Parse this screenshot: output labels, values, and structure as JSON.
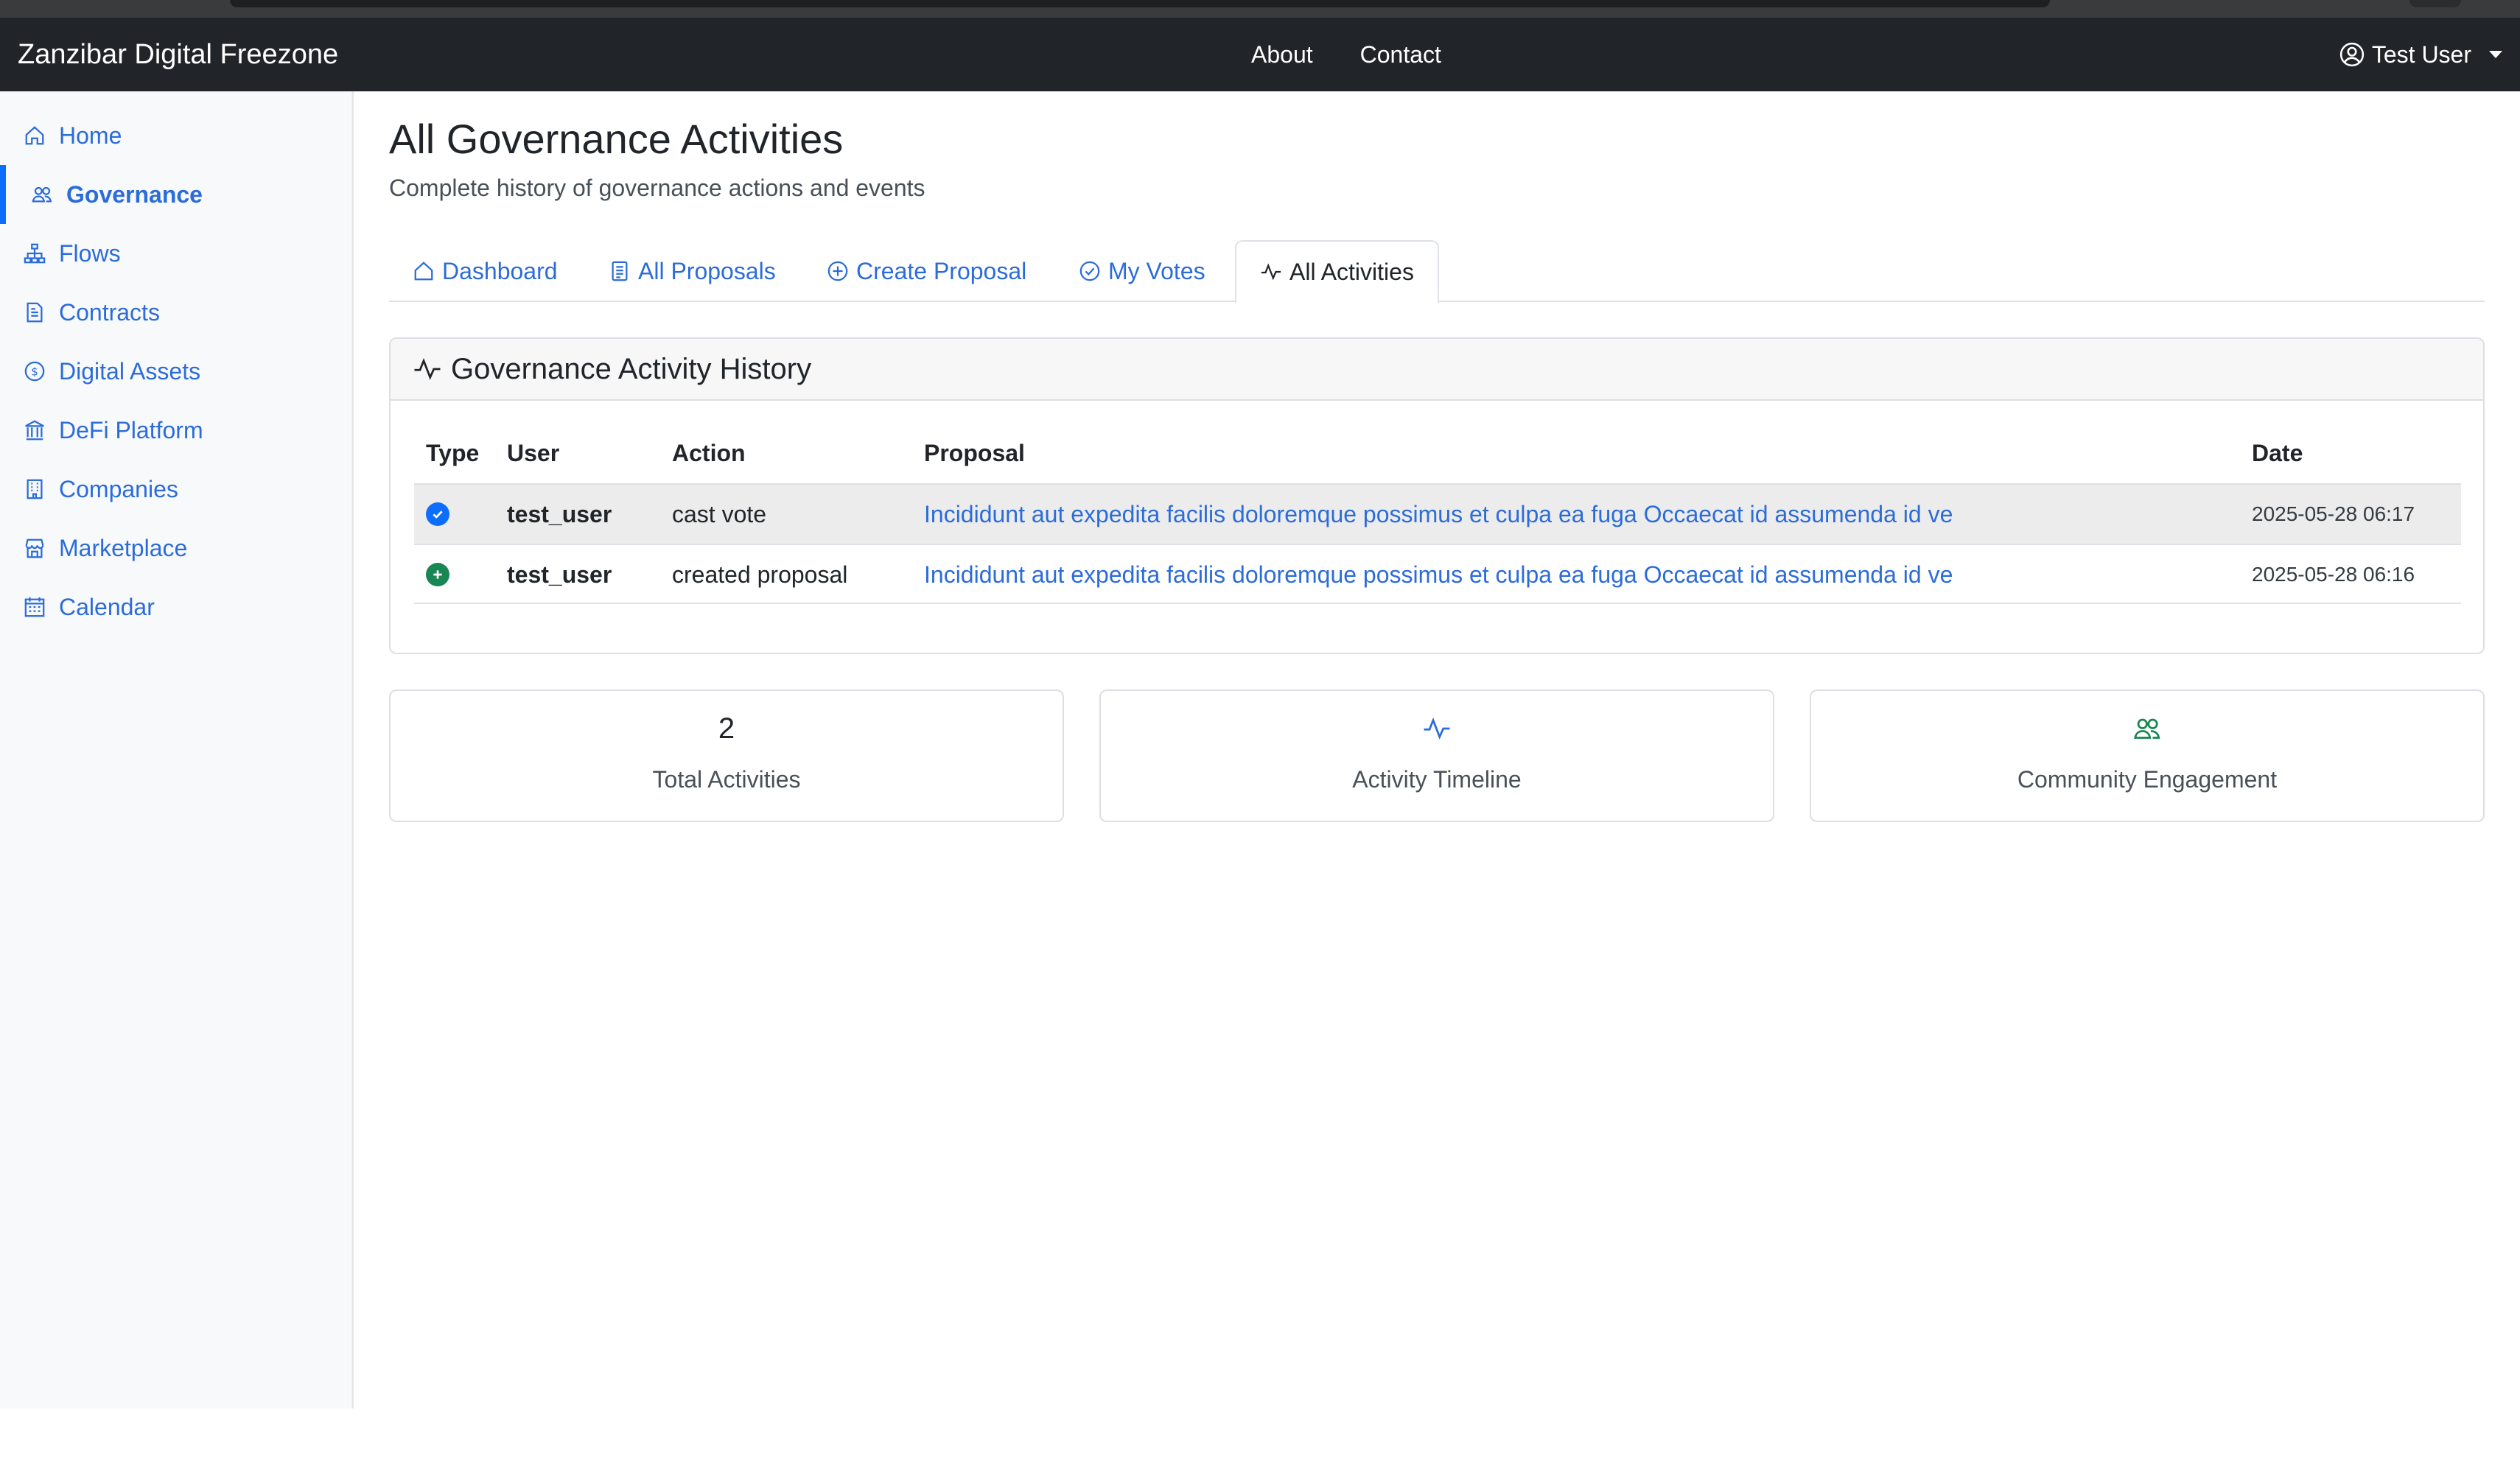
{
  "colors": {
    "navbar": "#212529",
    "accent": "#0d6efd",
    "link": "#2b6cd9",
    "success": "#198754",
    "sidebar_bg": "#f8f9fa"
  },
  "navbar": {
    "brand": "Zanzibar Digital Freezone",
    "links": [
      "About",
      "Contact"
    ],
    "user": {
      "icon": "user-circle-icon",
      "label": "Test User"
    }
  },
  "sidebar": {
    "items": [
      {
        "label": "Home",
        "icon": "house-icon",
        "active": false
      },
      {
        "label": "Governance",
        "icon": "people-icon",
        "active": true
      },
      {
        "label": "Flows",
        "icon": "diagram-icon",
        "active": false
      },
      {
        "label": "Contracts",
        "icon": "document-icon",
        "active": false
      },
      {
        "label": "Digital Assets",
        "icon": "coin-icon",
        "active": false
      },
      {
        "label": "DeFi Platform",
        "icon": "bank-icon",
        "active": false
      },
      {
        "label": "Companies",
        "icon": "building-icon",
        "active": false
      },
      {
        "label": "Marketplace",
        "icon": "shop-icon",
        "active": false
      },
      {
        "label": "Calendar",
        "icon": "calendar-icon",
        "active": false
      }
    ]
  },
  "page": {
    "title": "All Governance Activities",
    "subtitle": "Complete history of governance actions and events"
  },
  "tabs": [
    {
      "label": "Dashboard",
      "icon": "house-icon",
      "active": false
    },
    {
      "label": "All Proposals",
      "icon": "file-text-icon",
      "active": false
    },
    {
      "label": "Create Proposal",
      "icon": "plus-circle-icon",
      "active": false
    },
    {
      "label": "My Votes",
      "icon": "check-circle-icon",
      "active": false
    },
    {
      "label": "All Activities",
      "icon": "activity-icon",
      "active": true
    }
  ],
  "activity_card": {
    "title": "Governance Activity History",
    "columns": [
      "Type",
      "User",
      "Action",
      "Proposal",
      "Date"
    ],
    "rows": [
      {
        "type_icon": "check-circle-fill-icon",
        "user": "test_user",
        "action": "cast vote",
        "proposal": "Incididunt aut expedita facilis doloremque possimus et culpa ea fuga Occaecat id assumenda id ve",
        "date": "2025-05-28 06:17"
      },
      {
        "type_icon": "plus-circle-fill-icon",
        "user": "test_user",
        "action": "created proposal",
        "proposal": "Incididunt aut expedita facilis doloremque possimus et culpa ea fuga Occaecat id assumenda id ve",
        "date": "2025-05-28 06:16"
      }
    ]
  },
  "stats": [
    {
      "value": "2",
      "label": "Total Activities"
    },
    {
      "icon": "activity-icon",
      "label": "Activity Timeline"
    },
    {
      "icon": "people-icon",
      "label": "Community Engagement"
    }
  ]
}
